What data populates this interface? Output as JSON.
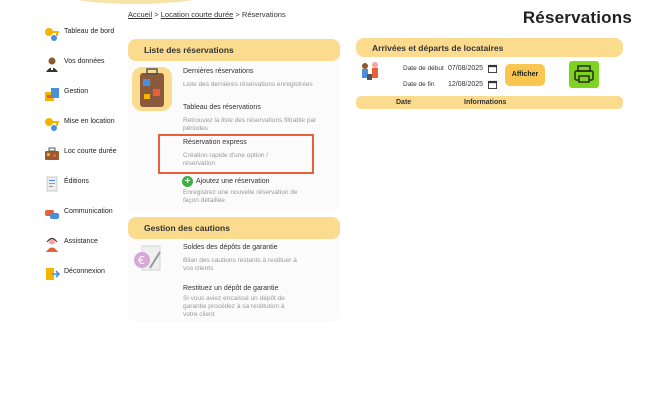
{
  "breadcrumb": {
    "home": "Accueil",
    "sep1": ">",
    "section": "Location courte durée",
    "sep2": ">",
    "current": "Réservations"
  },
  "page_title": "Réservations",
  "sidebar": {
    "items": [
      {
        "label": "Tableau de bord",
        "icon": "key-icon"
      },
      {
        "label": "Vos données",
        "icon": "user-icon"
      },
      {
        "label": "Gestion",
        "icon": "management-icon"
      },
      {
        "label": "Mise en location",
        "icon": "key-icon"
      },
      {
        "label": "Loc courte durée",
        "icon": "suitcase-icon"
      },
      {
        "label": "Éditions",
        "icon": "document-icon"
      },
      {
        "label": "Communication",
        "icon": "chat-icon"
      },
      {
        "label": "Assistance",
        "icon": "support-icon"
      },
      {
        "label": "Déconnexion",
        "icon": "logout-icon"
      }
    ]
  },
  "reservations_card": {
    "header": "Liste des réservations",
    "entries": [
      {
        "title": "Dernières réservations",
        "desc": "Liste des dernières réservations enregistrées"
      },
      {
        "title": "Tableau des réservations",
        "desc": "Retrouvez la liste des réservations filtrable par périodes"
      },
      {
        "title": "Réservation express",
        "desc": "Création rapide d'une option / réservation"
      }
    ],
    "add_label": "Ajoutez une réservation",
    "add_desc": "Enregistrez une nouvelle réservation de façon détaillée"
  },
  "caution_card": {
    "header": "Gestion des cautions",
    "entries": [
      {
        "title": "Soldes des dépôts de garantie",
        "desc": "Bilan des cautions restants à restituer à vos clients"
      },
      {
        "title": "Restituez un dépôt de garantie",
        "desc": "Si vous aviez encaissé un dépôt de garantie procédez à sa restitution à votre client"
      }
    ]
  },
  "arrivals_card": {
    "header": "Arrivées et départs de locataires",
    "start_label": "Date de début",
    "start_value": "07/08/2025",
    "end_label": "Date de fin",
    "end_value": "12/08/2025",
    "show_button": "Afficher",
    "table": {
      "col_date": "Date",
      "col_info": "Informations"
    }
  },
  "colors": {
    "header_bg": "#fbdc8f",
    "highlight": "#e8603a",
    "add_green": "#3cb043",
    "print_green": "#7ed321",
    "button_yellow": "#f9c74f"
  }
}
